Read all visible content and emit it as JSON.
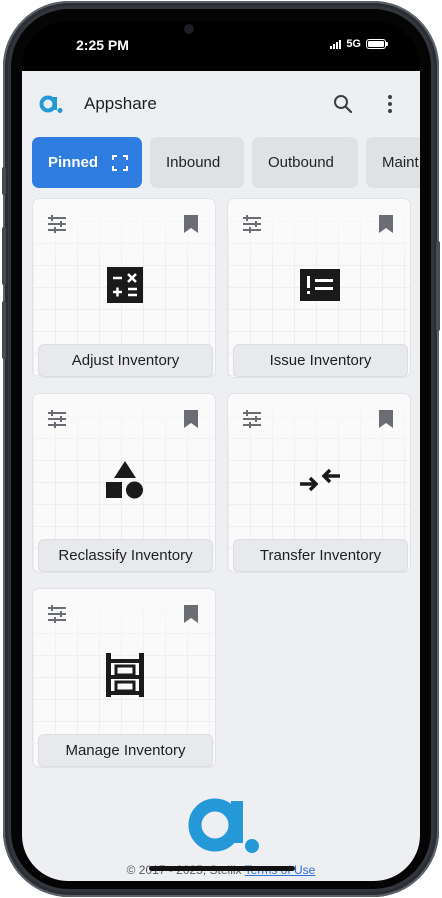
{
  "status_bar": {
    "time": "2:25 PM",
    "network": "5G"
  },
  "app_bar": {
    "title": "Appshare",
    "search_icon": "search-icon",
    "menu_icon": "more-vertical-icon"
  },
  "tabs": [
    {
      "label": "Pinned",
      "active": true,
      "icon": "expand-icon"
    },
    {
      "label": "Inbound",
      "active": false
    },
    {
      "label": "Outbound",
      "active": false
    },
    {
      "label": "Maint",
      "active": false
    }
  ],
  "cards": [
    {
      "label": "Adjust Inventory",
      "icon": "calculator-icon"
    },
    {
      "label": "Issue Inventory",
      "icon": "list-alert-icon"
    },
    {
      "label": "Reclassify Inventory",
      "icon": "shapes-icon"
    },
    {
      "label": "Transfer Inventory",
      "icon": "arrows-converge-icon"
    },
    {
      "label": "Manage Inventory",
      "icon": "shelving-icon"
    }
  ],
  "footer": {
    "copyright": "© 2017 - 2025, Stellix",
    "terms_link": "Terms of Use"
  },
  "colors": {
    "accent": "#2f7de0",
    "logo": "#2598d8",
    "background": "#eeeff2"
  }
}
